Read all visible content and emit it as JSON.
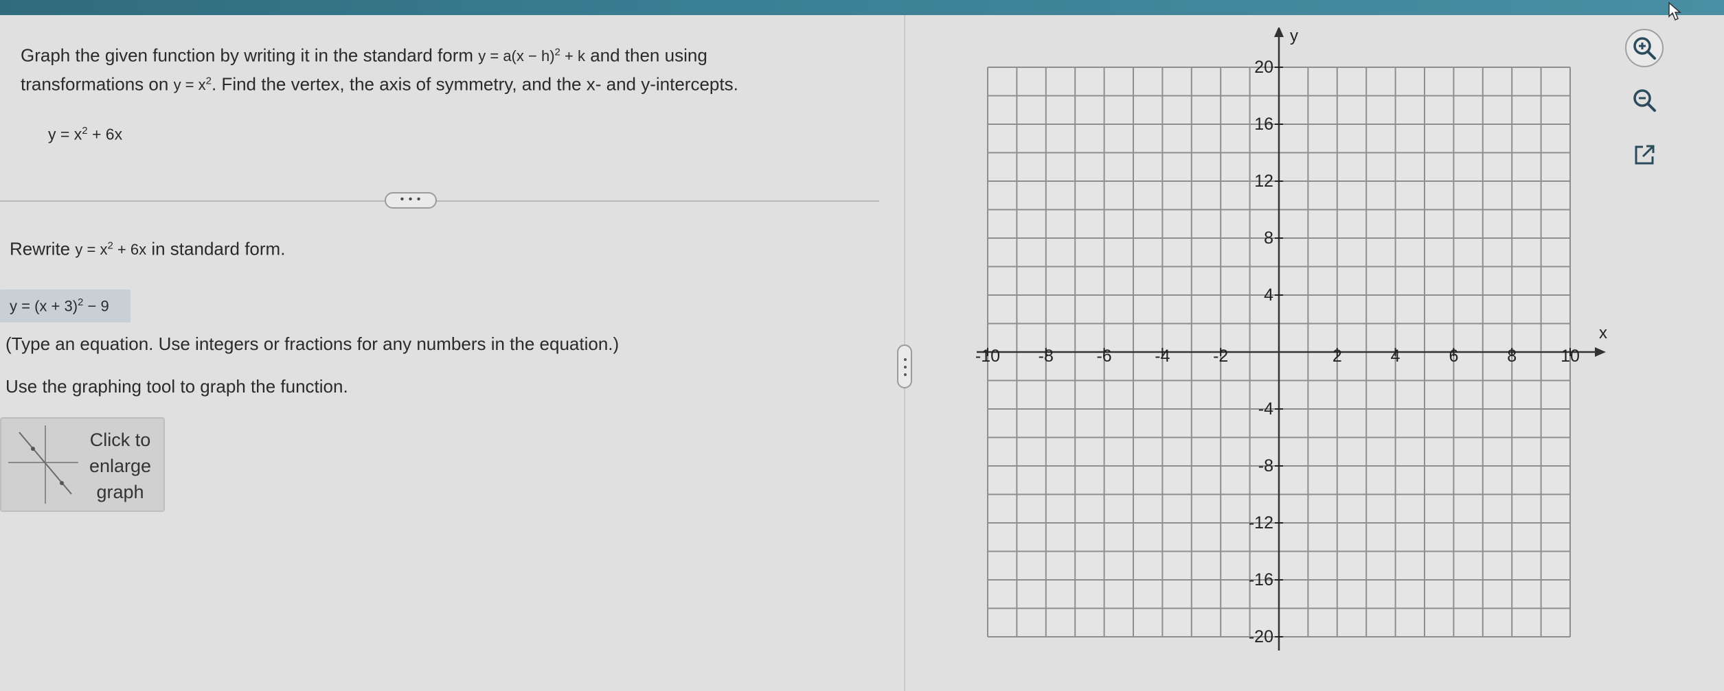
{
  "question": {
    "line1_pre": "Graph the given function by writing it in the standard form",
    "line1_formula_base": "y = a(x − h)",
    "line1_formula_exp": "2",
    "line1_formula_tail": " + k",
    "line1_post": "and then using",
    "line2_pre": "transformations on",
    "line2_formula_base": "y = x",
    "line2_formula_exp": "2",
    "line2_post": ". Find the vertex, the axis of symmetry, and the x- and y-intercepts.",
    "function_base": "y = x",
    "function_exp": "2",
    "function_tail": " + 6x"
  },
  "more_button": "• • •",
  "step": {
    "rewrite_pre": "Rewrite",
    "rewrite_base": "y = x",
    "rewrite_exp": "2",
    "rewrite_tail": " + 6x",
    "rewrite_post": "in standard form.",
    "answer_base": "y = (x + 3)",
    "answer_exp": "2",
    "answer_tail": " − 9",
    "hint": "(Type an equation. Use integers or fractions for any numbers in the equation.)",
    "graph_instruction": "Use the graphing tool to graph the function."
  },
  "enlarge": {
    "line1": "Click to",
    "line2": "enlarge",
    "line3": "graph"
  },
  "graph": {
    "x_axis_label": "x",
    "y_axis_label": "y",
    "x_ticks": [
      {
        "value": -10,
        "label": "-10"
      },
      {
        "value": -8,
        "label": "-8"
      },
      {
        "value": -6,
        "label": "-6"
      },
      {
        "value": -4,
        "label": "-4"
      },
      {
        "value": -2,
        "label": "-2"
      },
      {
        "value": 2,
        "label": "2"
      },
      {
        "value": 4,
        "label": "4"
      },
      {
        "value": 6,
        "label": "6"
      },
      {
        "value": 8,
        "label": "8"
      },
      {
        "value": 10,
        "label": "10"
      }
    ],
    "y_ticks": [
      {
        "value": 20,
        "label": "20"
      },
      {
        "value": 16,
        "label": "16"
      },
      {
        "value": 12,
        "label": "12"
      },
      {
        "value": 8,
        "label": "8"
      },
      {
        "value": 4,
        "label": "4"
      },
      {
        "value": -4,
        "label": "-4"
      },
      {
        "value": -8,
        "label": "-8"
      },
      {
        "value": -12,
        "label": "-12"
      },
      {
        "value": -16,
        "label": "-16"
      },
      {
        "value": -20,
        "label": "-20"
      }
    ],
    "x_range": [
      -10,
      10
    ],
    "y_range": [
      -20,
      20
    ],
    "x_grid_step": 1,
    "y_grid_step": 2
  },
  "tools": {
    "zoom_in": "zoom-in-icon",
    "zoom_out": "zoom-out-icon",
    "popout": "popout-icon"
  },
  "colors": {
    "grid_line": "#8c8f91",
    "axis": "#333333",
    "answer_highlight": "#c8d0d6"
  }
}
